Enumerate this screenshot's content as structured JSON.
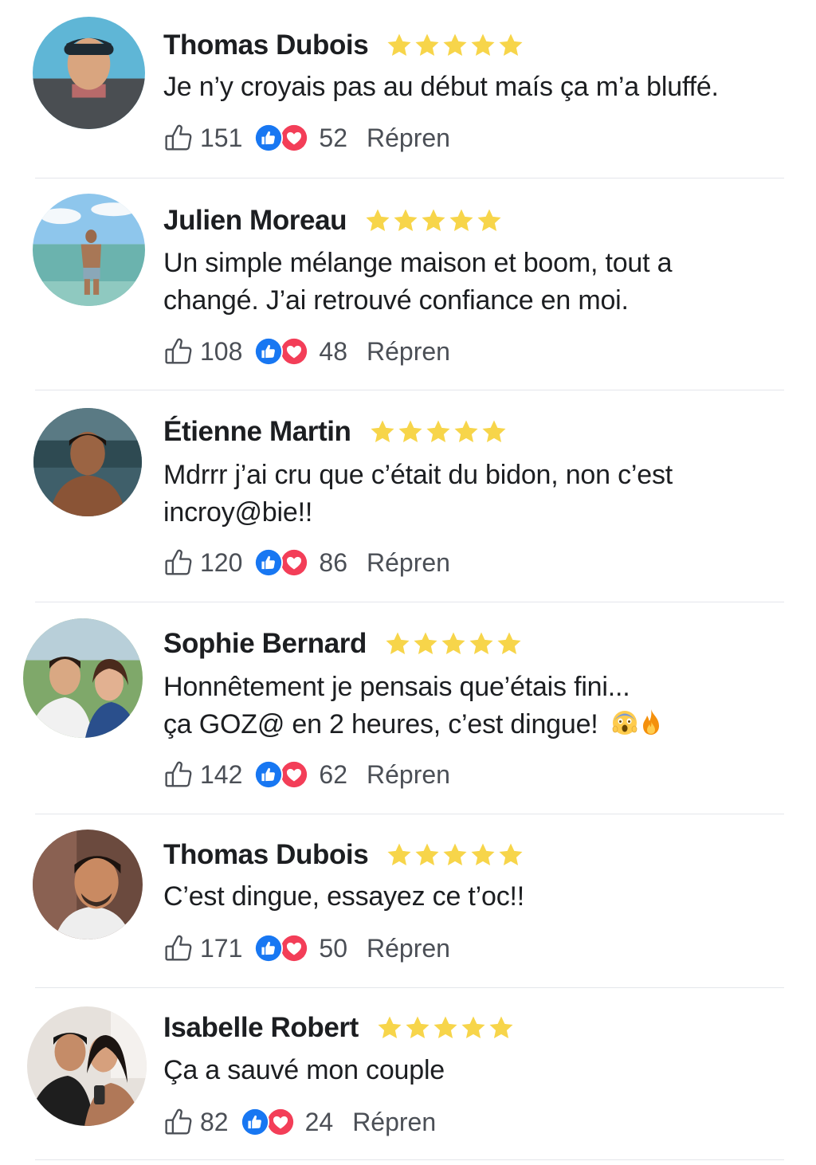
{
  "colors": {
    "star": "#f7d54a",
    "like_blue": "#1877f2",
    "love_red": "#f33e58",
    "divider": "#e4e6eb",
    "text": "#1c1e21",
    "meta": "#4b4f56"
  },
  "comments": [
    {
      "name": "Thomas Dubois",
      "rating": 5,
      "lines": [
        "Je n’y croyais pas au début maís ça m’a bluffé."
      ],
      "likes": "151",
      "reactions": "52",
      "reply_label": "Répren",
      "emojis": []
    },
    {
      "name": "Julien Moreau",
      "rating": 5,
      "lines": [
        "Un simple mélange maison et boom, tout a",
        "changé. J’ai retrouvé confiance en moi."
      ],
      "likes": "108",
      "reactions": "48",
      "reply_label": "Répren",
      "emojis": []
    },
    {
      "name": "Étienne Martin",
      "rating": 5,
      "lines": [
        "Mdrrr j’ai cru que c’était du bidon, non c’est",
        "incroy@bie!!"
      ],
      "likes": "120",
      "reactions": "86",
      "reply_label": "Répren",
      "emojis": []
    },
    {
      "name": "Sophie Bernard",
      "rating": 5,
      "lines": [
        "Honnêtement je pensais que’étais fini...",
        "ça GOZ@ en 2 heures, c’est dingue!"
      ],
      "likes": "142",
      "reactions": "62",
      "reply_label": "Répren",
      "emojis": [
        "screaming-face",
        "fire"
      ]
    },
    {
      "name": "Thomas Dubois",
      "rating": 5,
      "lines": [
        "C’est dingue, essayez ce t’oc!!"
      ],
      "likes": "171",
      "reactions": "50",
      "reply_label": "Répren",
      "emojis": []
    },
    {
      "name": "Isabelle Robert",
      "rating": 5,
      "lines": [
        "Ça a sauvé mon couple"
      ],
      "likes": "82",
      "reactions": "24",
      "reply_label": "Répren",
      "emojis": []
    }
  ]
}
